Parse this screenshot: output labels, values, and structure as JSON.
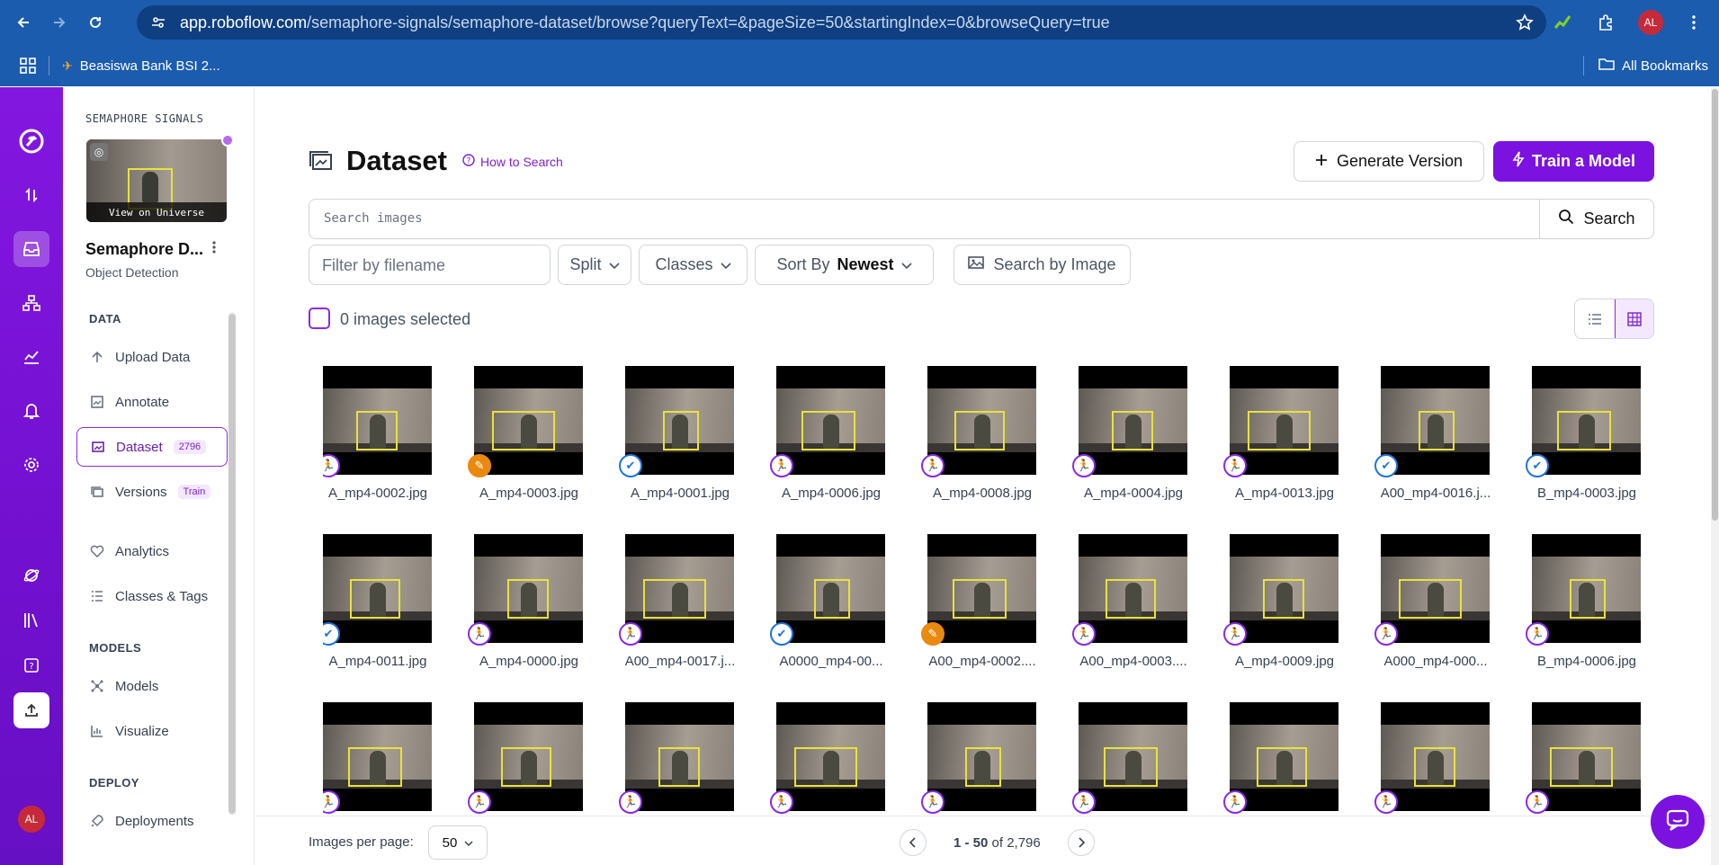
{
  "browser": {
    "url_host": "app.roboflow.com",
    "url_path": "/semaphore-signals/semaphore-dataset/browse?queryText=&pageSize=50&startingIndex=0&browseQuery=true",
    "bookmark": "Beasiswa Bank BSI 2...",
    "all_bookmarks": "All Bookmarks",
    "profile_initials": "AL"
  },
  "rail": {
    "avatar": "AL"
  },
  "project": {
    "workspace_label": "SEMAPHORE SIGNALS",
    "universe_caption": "View on Universe",
    "name": "Semaphore D...",
    "type": "Object Detection"
  },
  "sidebar": {
    "sections": {
      "data": "DATA",
      "models": "MODELS",
      "deploy": "DEPLOY"
    },
    "items": [
      {
        "label": "Upload Data",
        "icon": "upload-icon"
      },
      {
        "label": "Annotate",
        "icon": "annotate-icon"
      },
      {
        "label": "Dataset",
        "icon": "dataset-icon",
        "badge": "2796",
        "active": true
      },
      {
        "label": "Versions",
        "icon": "versions-icon",
        "badge": "Train"
      },
      {
        "label": "Analytics",
        "icon": "heart-pulse-icon"
      },
      {
        "label": "Classes & Tags",
        "icon": "list-icon"
      },
      {
        "label": "Models",
        "icon": "models-icon"
      },
      {
        "label": "Visualize",
        "icon": "chart-icon"
      },
      {
        "label": "Deployments",
        "icon": "rocket-icon"
      }
    ]
  },
  "main": {
    "title": "Dataset",
    "how_to_search": "How to Search",
    "generate_version": "Generate Version",
    "train_model": "Train a Model",
    "search_placeholder": "Search images",
    "search_button": "Search",
    "filter_placeholder": "Filter by filename",
    "split": "Split",
    "classes": "Classes",
    "sort_by": "Sort By",
    "sort_value": "Newest",
    "search_by_image": "Search by Image",
    "selected_text": "0 images selected",
    "accent_color": "#7b12e0"
  },
  "images": [
    {
      "name": "A_mp4-0002.jpg",
      "status": "annotated"
    },
    {
      "name": "A_mp4-0003.jpg",
      "status": "in-progress"
    },
    {
      "name": "A_mp4-0001.jpg",
      "status": "approved"
    },
    {
      "name": "A_mp4-0006.jpg",
      "status": "annotated"
    },
    {
      "name": "A_mp4-0008.jpg",
      "status": "annotated"
    },
    {
      "name": "A_mp4-0004.jpg",
      "status": "annotated"
    },
    {
      "name": "A_mp4-0013.jpg",
      "status": "annotated"
    },
    {
      "name": "A00_mp4-0016.j...",
      "status": "approved"
    },
    {
      "name": "B_mp4-0003.jpg",
      "status": "approved"
    },
    {
      "name": "A_mp4-0011.jpg",
      "status": "approved"
    },
    {
      "name": "A_mp4-0000.jpg",
      "status": "annotated"
    },
    {
      "name": "A00_mp4-0017.j...",
      "status": "annotated"
    },
    {
      "name": "A0000_mp4-00...",
      "status": "approved"
    },
    {
      "name": "A00_mp4-0002....",
      "status": "in-progress"
    },
    {
      "name": "A00_mp4-0003....",
      "status": "annotated"
    },
    {
      "name": "A_mp4-0009.jpg",
      "status": "annotated"
    },
    {
      "name": "A000_mp4-000...",
      "status": "annotated"
    },
    {
      "name": "B_mp4-0006.jpg",
      "status": "annotated"
    },
    {
      "name": "",
      "status": "annotated"
    },
    {
      "name": "",
      "status": "annotated"
    },
    {
      "name": "",
      "status": "annotated"
    },
    {
      "name": "",
      "status": "annotated"
    },
    {
      "name": "",
      "status": "annotated"
    },
    {
      "name": "",
      "status": "annotated"
    },
    {
      "name": "",
      "status": "annotated"
    },
    {
      "name": "",
      "status": "annotated"
    },
    {
      "name": "",
      "status": "annotated"
    }
  ],
  "footer": {
    "per_page_label": "Images per page:",
    "per_page_value": "50",
    "range": "1 - 50",
    "of_total": "of 2,796"
  }
}
